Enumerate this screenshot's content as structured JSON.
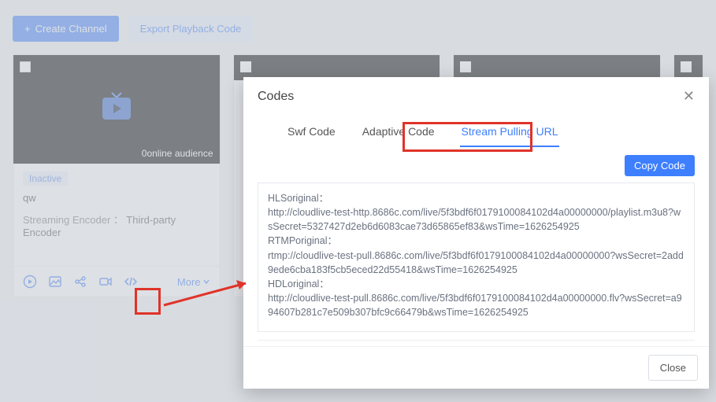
{
  "toolbar": {
    "create_label": "Create Channel",
    "export_label": "Export Playback Code"
  },
  "card": {
    "audience": "0online audience",
    "status": "Inactive",
    "title": "qw",
    "meta_label": "Streaming Encoder ：",
    "meta_value": "Third-party Encoder",
    "more": "More"
  },
  "modal": {
    "title": "Codes",
    "tabs": {
      "swf": "Swf Code",
      "adaptive": "Adaptive Code",
      "pull": "Stream Pulling URL"
    },
    "copy": "Copy Code",
    "close": "Close",
    "codes": {
      "hls_label": "HLSoriginal：",
      "hls_url": "http://cloudlive-test-http.8686c.com/live/5f3bdf6f0179100084102d4a00000000/playlist.m3u8?wsSecret=5327427d2eb6d6083cae73d65865ef83&wsTime=1626254925",
      "rtmp_label": "RTMPoriginal：",
      "rtmp_url": "rtmp://cloudlive-test-pull.8686c.com/live/5f3bdf6f0179100084102d4a00000000?wsSecret=2add9ede6cba183f5cb5eced22d55418&wsTime=1626254925",
      "hdl_label": "HDLoriginal：",
      "hdl_url": "http://cloudlive-test-pull.8686c.com/live/5f3bdf6f0179100084102d4a00000000.flv?wsSecret=a994607b281c7e509b307bfc9c66479b&wsTime=1626254925"
    }
  },
  "colors": {
    "primary": "#3d7fff",
    "annotation": "#e0332a"
  }
}
